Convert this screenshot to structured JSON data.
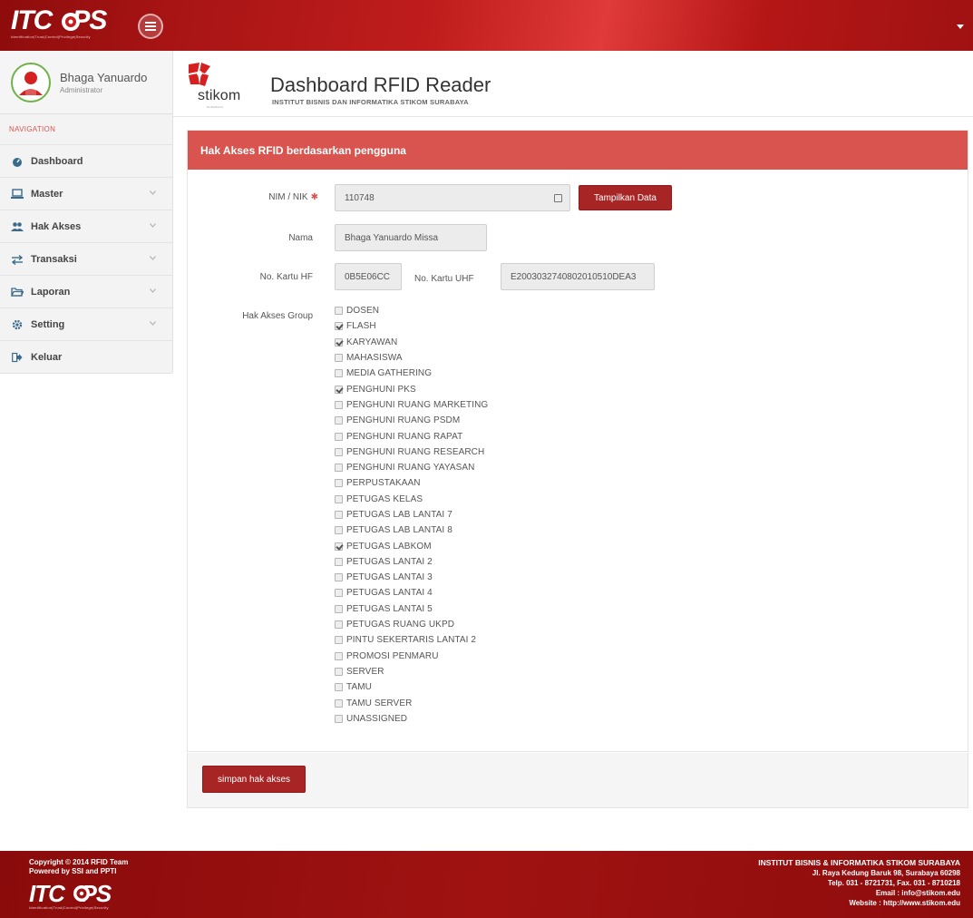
{
  "brand": {
    "logo_text": "ITC   PS",
    "logo_tagline": "Identification|Trust|Control|Privilege|Security"
  },
  "user": {
    "name": "Bhaga Yanuardo",
    "role": "Administrator"
  },
  "sidebar": {
    "header": "NAVIGATION",
    "items": [
      {
        "label": "Dashboard",
        "has_submenu": false
      },
      {
        "label": "Master",
        "has_submenu": true
      },
      {
        "label": "Hak Akses",
        "has_submenu": true
      },
      {
        "label": "Transaksi",
        "has_submenu": true
      },
      {
        "label": "Laporan",
        "has_submenu": true
      },
      {
        "label": "Setting",
        "has_submenu": true
      },
      {
        "label": "Keluar",
        "has_submenu": false
      }
    ]
  },
  "header": {
    "org_word": "stikom",
    "org_sub": "SURABAYA",
    "title": "Dashboard RFID Reader",
    "subtitle": "INSTITUT BISNIS DAN INFORMATIKA STIKOM SURABAYA"
  },
  "panel": {
    "heading": "Hak Akses RFID berdasarkan pengguna",
    "nim_label": "NIM / NIK",
    "nim_required_mark": "✱",
    "nim_value": "110748",
    "show_button": "Tampilkan Data",
    "nama_label": "Nama",
    "nama_value": "Bhaga Yanuardo Missa",
    "kartu_hf_label": "No. Kartu HF",
    "kartu_hf_value": "0B5E06CC",
    "kartu_uhf_label": "No. Kartu UHF",
    "kartu_uhf_value": "E2003032740802010510DEA3",
    "group_label": "Hak Akses Group",
    "groups": [
      {
        "label": "DOSEN",
        "checked": false
      },
      {
        "label": "FLASH",
        "checked": true
      },
      {
        "label": "KARYAWAN",
        "checked": true
      },
      {
        "label": "MAHASISWA",
        "checked": false
      },
      {
        "label": "MEDIA GATHERING",
        "checked": false
      },
      {
        "label": "PENGHUNI PKS",
        "checked": true
      },
      {
        "label": "PENGHUNI RUANG MARKETING",
        "checked": false
      },
      {
        "label": "PENGHUNI RUANG PSDM",
        "checked": false
      },
      {
        "label": "PENGHUNI RUANG RAPAT",
        "checked": false
      },
      {
        "label": "PENGHUNI RUANG RESEARCH",
        "checked": false
      },
      {
        "label": "PENGHUNI RUANG YAYASAN",
        "checked": false
      },
      {
        "label": "PERPUSTAKAAN",
        "checked": false
      },
      {
        "label": "PETUGAS KELAS",
        "checked": false
      },
      {
        "label": "PETUGAS LAB LANTAI 7",
        "checked": false
      },
      {
        "label": "PETUGAS LAB LANTAI 8",
        "checked": false
      },
      {
        "label": "PETUGAS LABKOM",
        "checked": true
      },
      {
        "label": "PETUGAS LANTAI 2",
        "checked": false
      },
      {
        "label": "PETUGAS LANTAI 3",
        "checked": false
      },
      {
        "label": "PETUGAS LANTAI 4",
        "checked": false
      },
      {
        "label": "PETUGAS LANTAI 5",
        "checked": false
      },
      {
        "label": "PETUGAS RUANG UKPD",
        "checked": false
      },
      {
        "label": "PINTU SEKERTARIS LANTAI 2",
        "checked": false
      },
      {
        "label": "PROMOSI PENMARU",
        "checked": false
      },
      {
        "label": "SERVER",
        "checked": false
      },
      {
        "label": "TAMU",
        "checked": false
      },
      {
        "label": "TAMU SERVER",
        "checked": false
      },
      {
        "label": "UNASSIGNED",
        "checked": false
      }
    ],
    "save_button": "simpan hak akses"
  },
  "footer": {
    "copyright": "Copyright © 2014 RFID Team",
    "powered": "Powered by SSI and PPTI",
    "logo_text": "ITC   PS",
    "logo_tagline": "Identification|Trust|Control|Privilege|Security",
    "institution": "INSTITUT BISNIS & INFORMATIKA STIKOM SURABAYA",
    "address": "Jl. Raya Kedung Baruk 98, Surabaya 60298",
    "phone": "Telp. 031 - 8721731, Fax. 031 - 8710218",
    "email": "Email : info@stikom.edu",
    "website": "Website : http://www.stikom.edu"
  },
  "colors": {
    "primary_red": "#d9534f",
    "dark_red": "#a82525",
    "topbar_red": "#b51616"
  }
}
